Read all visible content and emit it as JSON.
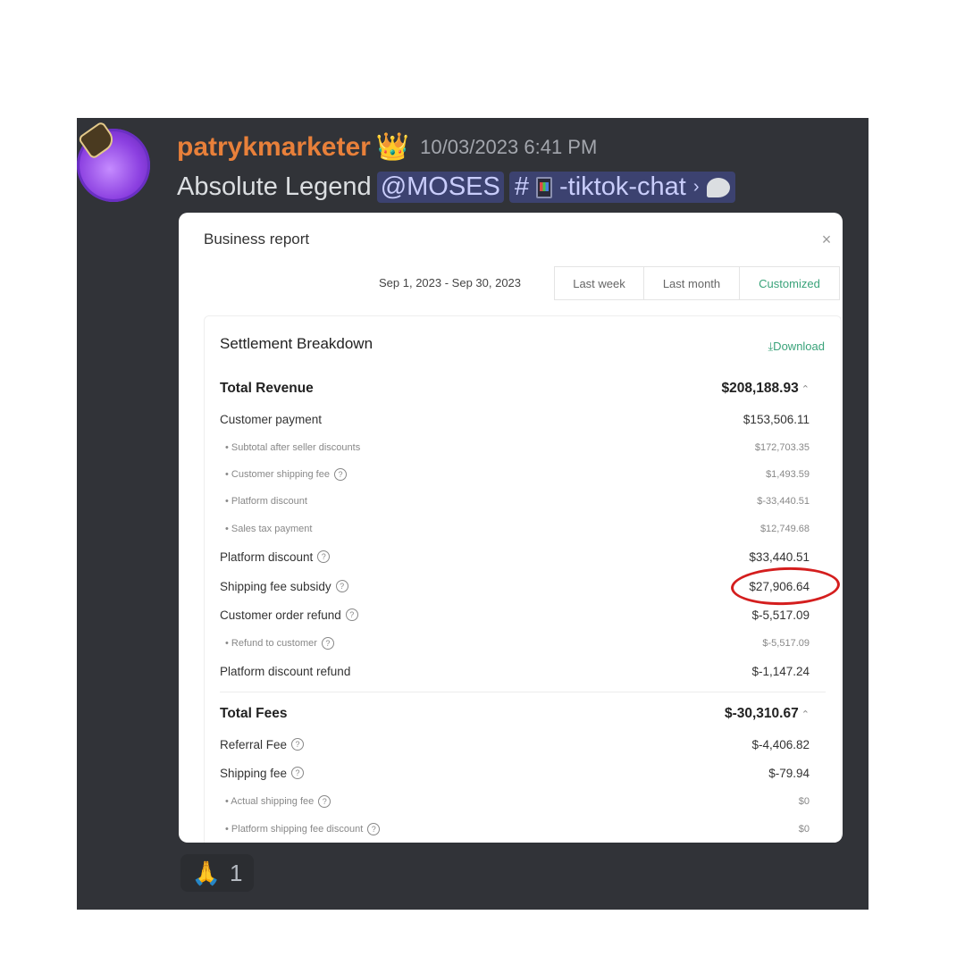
{
  "message": {
    "username": "patrykmarketer",
    "timestamp": "10/03/2023 6:41 PM",
    "text": "Absolute Legend",
    "mention": "@MOSES",
    "channel_hash": "#",
    "channel_name": "-tiktok-chat",
    "chevron": "›",
    "icons": [
      "crown-icon",
      "calculator-icon",
      "chat-bubble-icon"
    ]
  },
  "report": {
    "title": "Business report",
    "close": "×",
    "date_range": "Sep 1, 2023 - Sep 30, 2023",
    "tabs": [
      "Last week",
      "Last month",
      "Customized"
    ],
    "active_tab": "Customized",
    "section_title": "Settlement Breakdown",
    "download": "⤓Download",
    "rows": [
      {
        "label": "Total Revenue",
        "value": "$208,188.93"
      },
      {
        "label": "Customer payment",
        "value": "$153,506.11"
      },
      {
        "label": "• Subtotal after seller discounts",
        "value": "$172,703.35"
      },
      {
        "label": "• Customer shipping fee",
        "value": "$1,493.59"
      },
      {
        "label": "• Platform discount",
        "value": "$-33,440.51"
      },
      {
        "label": "• Sales tax payment",
        "value": "$12,749.68"
      },
      {
        "label": "Platform discount",
        "value": "$33,440.51"
      },
      {
        "label": "Shipping fee subsidy",
        "value": "$27,906.64"
      },
      {
        "label": "Customer order refund",
        "value": "$-5,517.09"
      },
      {
        "label": "• Refund to customer",
        "value": "$-5,517.09"
      },
      {
        "label": "Platform discount refund",
        "value": "$-1,147.24"
      },
      {
        "label": "Total Fees",
        "value": "$-30,310.67"
      },
      {
        "label": "Referral Fee",
        "value": "$-4,406.82"
      },
      {
        "label": "Shipping fee",
        "value": "$-79.94"
      },
      {
        "label": "• Actual shipping fee",
        "value": "$0"
      },
      {
        "label": "• Platform shipping fee discount",
        "value": "$0"
      }
    ],
    "help_glyph": "?"
  },
  "reaction": {
    "emoji": "🙏",
    "count": "1"
  },
  "colors": {
    "background": "#313338",
    "username": "#e8803a",
    "accent_green": "#3aa37a",
    "highlight_circle": "#d41e1e"
  }
}
